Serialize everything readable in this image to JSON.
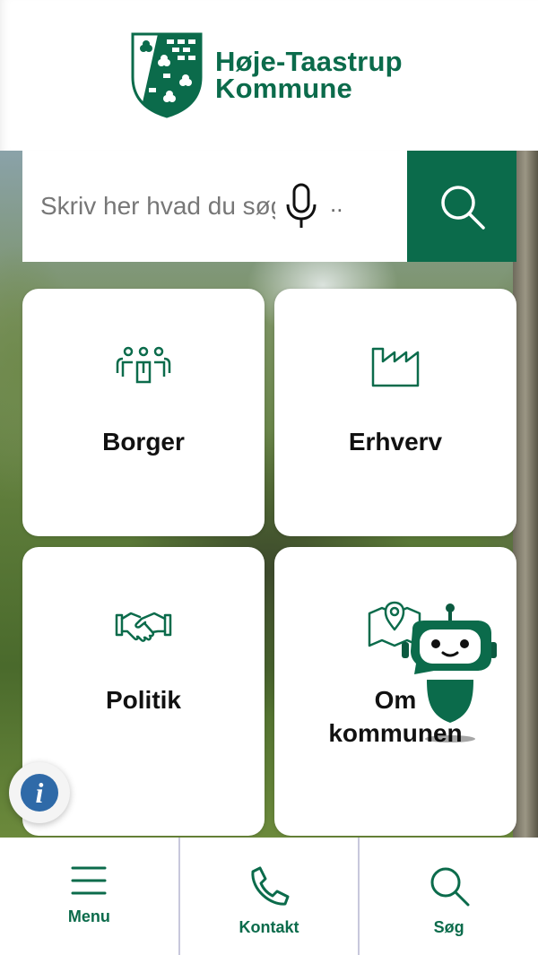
{
  "header": {
    "brand_line1": "Høje-Taastrup",
    "brand_line2": "Kommune"
  },
  "search": {
    "placeholder": "Skriv her hvad du søger",
    "ellipsis": ".."
  },
  "tiles": [
    {
      "label": "Borger",
      "icon": "people-icon"
    },
    {
      "label": "Erhverv",
      "icon": "factory-icon"
    },
    {
      "label": "Politik",
      "icon": "handshake-icon"
    },
    {
      "label": "Om kommunen",
      "icon": "map-pin-icon"
    }
  ],
  "bottom_nav": [
    {
      "label": "Menu",
      "icon": "hamburger-icon"
    },
    {
      "label": "Kontakt",
      "icon": "phone-icon"
    },
    {
      "label": "Søg",
      "icon": "search-icon"
    }
  ],
  "colors": {
    "brand": "#0b6b4b",
    "info": "#2f6aa8"
  }
}
